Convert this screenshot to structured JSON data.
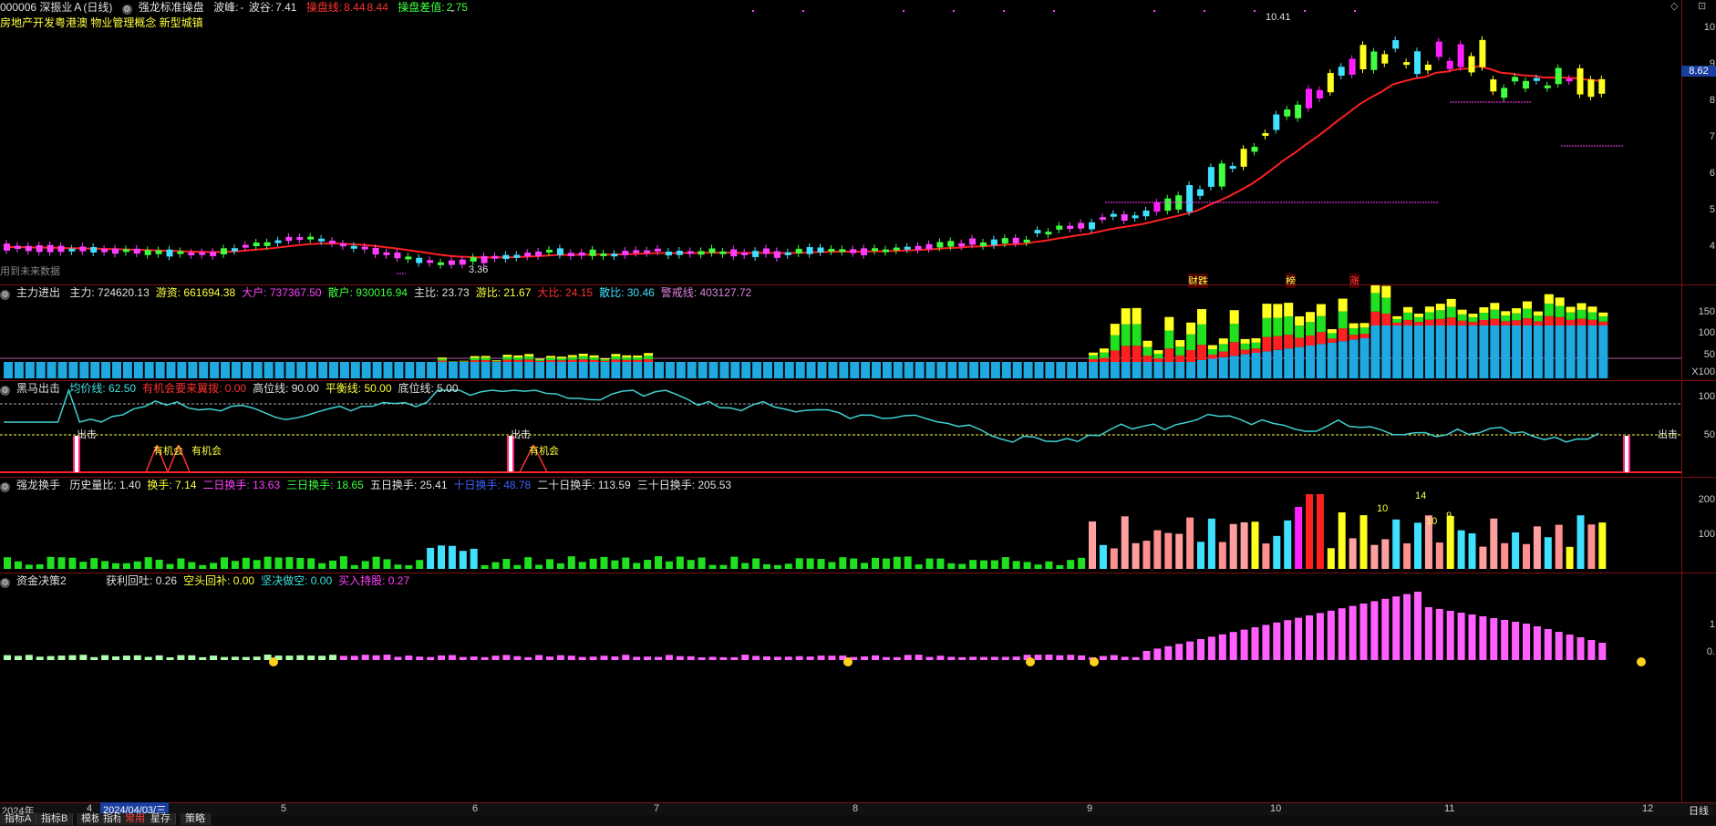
{
  "main": {
    "stock": "000006 深振业Ａ(日线)",
    "indicator": "强龙标准操盘",
    "wave_label": "波峰:",
    "wave_value": "-",
    "wave_trough_label": "波谷:",
    "wave_trough_value": "7.41",
    "trade_line_label": "操盘线:",
    "trade_line_value": "8.44",
    "trade_line_value2": "8.44",
    "trade_diff_label": "操盘差值:",
    "trade_diff_value": "2.75",
    "concepts": "房地产开发粤港澳 物业管理概念 新型城镇",
    "future_note": "用到未来数据",
    "high_mark": "10.41",
    "low_mark": "3.36",
    "current_price": "8.62",
    "tags": [
      "财跌",
      "榜",
      "涨"
    ],
    "y_labels": [
      "10",
      "9",
      "8",
      "7",
      "6",
      "5",
      "4"
    ]
  },
  "panel2": {
    "title": "主力进出",
    "items": [
      {
        "label": "主力:",
        "value": "724620.13",
        "color": "#e0e0e0"
      },
      {
        "label": "游资:",
        "value": "661694.38",
        "color": "#ffff40"
      },
      {
        "label": "大户:",
        "value": "737367.50",
        "color": "#ff40ff"
      },
      {
        "label": "散户:",
        "value": "930016.94",
        "color": "#40ff40"
      },
      {
        "label": "主比:",
        "value": "23.73",
        "color": "#e0e0e0"
      },
      {
        "label": "游比:",
        "value": "21.67",
        "color": "#ffff40"
      },
      {
        "label": "大比:",
        "value": "24.15",
        "color": "#ff3030"
      },
      {
        "label": "散比:",
        "value": "30.46",
        "color": "#40e0ff"
      },
      {
        "label": "警戒线:",
        "value": "403127.72",
        "color": "#e080e0"
      }
    ],
    "y_labels": [
      "150",
      "100",
      "50"
    ],
    "unit": "X100"
  },
  "panel3": {
    "title": "黑马出击",
    "items": [
      {
        "label": "均价线:",
        "value": "62.50",
        "color": "#40e0e0"
      },
      {
        "label": "有机会要来翼拨:",
        "value": "0.00",
        "color": "#ff3030"
      },
      {
        "label": "高位线:",
        "value": "90.00",
        "color": "#e0e0e0"
      },
      {
        "label": "平衡线:",
        "value": "50.00",
        "color": "#ffff40"
      },
      {
        "label": "底位线:",
        "value": "5.00",
        "color": "#e0e0e0"
      }
    ],
    "y_labels": [
      "100",
      "50"
    ],
    "marks": [
      "出击",
      "出击",
      "出击"
    ],
    "chance": [
      "有机会",
      "有机会",
      "有机会"
    ]
  },
  "panel4": {
    "title": "强龙换手",
    "items": [
      {
        "label": "历史量比:",
        "value": "1.40",
        "color": "#e0e0e0"
      },
      {
        "label": "换手:",
        "value": "7.14",
        "color": "#ffff40"
      },
      {
        "label": "二日换手:",
        "value": "13.63",
        "color": "#ff40ff"
      },
      {
        "label": "三日换手:",
        "value": "18.65",
        "color": "#40ff40"
      },
      {
        "label": "五日换手:",
        "value": "25.41",
        "color": "#e0e0e0"
      },
      {
        "label": "十日换手:",
        "value": "48.78",
        "color": "#4060ff"
      },
      {
        "label": "二十日换手:",
        "value": "113.59",
        "color": "#e0e0e0"
      },
      {
        "label": "三十日换手:",
        "value": "205.53",
        "color": "#e0e0e0"
      }
    ],
    "y_labels": [
      "200",
      "100"
    ],
    "peak_labels": [
      "14",
      "10",
      "10",
      "9"
    ]
  },
  "panel5": {
    "title": "资金决策2",
    "items": [
      {
        "label": "获利回吐:",
        "value": "0.26",
        "color": "#e0e0e0"
      },
      {
        "label": "空头回补:",
        "value": "0.00",
        "color": "#ffff40"
      },
      {
        "label": "坚决做空:",
        "value": "0.00",
        "color": "#40e0e0"
      },
      {
        "label": "买入持股:",
        "value": "0.27",
        "color": "#ff40ff"
      }
    ],
    "y_labels": [
      "1",
      "0."
    ]
  },
  "date_axis": {
    "labels": [
      "2024年",
      "4",
      "2024/04/03/三",
      "5",
      "6",
      "7",
      "8",
      "9",
      "10",
      "11",
      "12"
    ],
    "right_label": "日线"
  },
  "tabs": [
    "指标A",
    "指标B",
    "模板",
    "指标",
    "常用",
    "星存",
    "策略"
  ]
}
